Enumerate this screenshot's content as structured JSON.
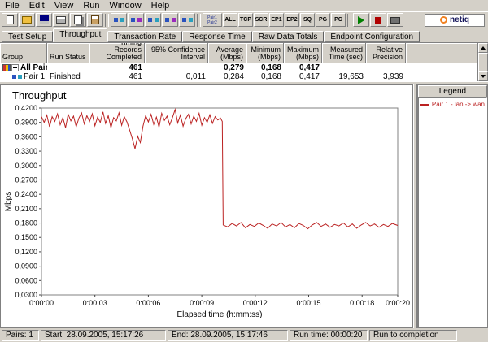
{
  "menubar": {
    "items": [
      "File",
      "Edit",
      "View",
      "Run",
      "Window",
      "Help"
    ]
  },
  "toolbar": {
    "filters": [
      "ALL",
      "TCP",
      "SCR",
      "EP1",
      "EP2",
      "SQ",
      "PG",
      "PC"
    ],
    "pair_sort": [
      "Pair1",
      "Pair2"
    ],
    "logo_text": "netiq"
  },
  "tabs": {
    "items": [
      "Test Setup",
      "Throughput",
      "Transaction Rate",
      "Response Time",
      "Raw Data Totals",
      "Endpoint Configuration"
    ],
    "active": "Throughput"
  },
  "results_table": {
    "headers": [
      "Group",
      "Run Status",
      "Timing Records\nCompleted",
      "95% Confidence\nInterval",
      "Average\n(Mbps)",
      "Minimum\n(Mbps)",
      "Maximum\n(Mbps)",
      "Measured\nTime (sec)",
      "Relative\nPrecision"
    ],
    "rows": [
      {
        "group": "All Pairs",
        "run_status": "",
        "records": "461",
        "ci": "",
        "avg": "0,279",
        "min": "0,168",
        "max": "0,417",
        "time": "",
        "precision": ""
      },
      {
        "group": "Pair 1",
        "run_status": "Finished",
        "records": "461",
        "ci": "0,011",
        "avg": "0,284",
        "min": "0,168",
        "max": "0,417",
        "time": "19,653",
        "precision": "3,939"
      }
    ]
  },
  "legend": {
    "title": "Legend",
    "entries": [
      {
        "label": "Pair 1 - lan -> wan",
        "color": "#bb2222"
      }
    ]
  },
  "statusbar": {
    "cells": [
      "Pairs: 1",
      "Start: 28.09.2005, 15:17:26",
      "End: 28.09.2005, 15:17:46",
      "Run time: 00:00:20",
      "Run to completion"
    ]
  },
  "chart_data": {
    "type": "line",
    "title": "Throughput",
    "xlabel": "Elapsed time (h:mm:ss)",
    "ylabel": "Mbps",
    "ylim": [
      0.03,
      0.42
    ],
    "xlim": [
      0,
      20
    ],
    "grid": false,
    "legend_position": "right-panel",
    "yticks": [
      {
        "v": 0.42,
        "label": "0,4200"
      },
      {
        "v": 0.39,
        "label": "0,3900"
      },
      {
        "v": 0.36,
        "label": "0,3600"
      },
      {
        "v": 0.33,
        "label": "0,3300"
      },
      {
        "v": 0.3,
        "label": "0,3000"
      },
      {
        "v": 0.27,
        "label": "0,2700"
      },
      {
        "v": 0.24,
        "label": "0,2400"
      },
      {
        "v": 0.21,
        "label": "0,2100"
      },
      {
        "v": 0.18,
        "label": "0,1800"
      },
      {
        "v": 0.15,
        "label": "0,1500"
      },
      {
        "v": 0.12,
        "label": "0,1200"
      },
      {
        "v": 0.09,
        "label": "0,0900"
      },
      {
        "v": 0.06,
        "label": "0,0600"
      },
      {
        "v": 0.03,
        "label": "0,0300"
      }
    ],
    "xticks": [
      {
        "t": 0,
        "label": "0:00:00"
      },
      {
        "t": 3,
        "label": "0:00:03"
      },
      {
        "t": 6,
        "label": "0:00:06"
      },
      {
        "t": 9,
        "label": "0:00:09"
      },
      {
        "t": 12,
        "label": "0:00:12"
      },
      {
        "t": 15,
        "label": "0:00:15"
      },
      {
        "t": 18,
        "label": "0:00:18"
      },
      {
        "t": 20,
        "label": "0:00:20"
      }
    ],
    "series": [
      {
        "name": "Pair 1 - lan -> wan",
        "color": "#bb2222",
        "points": [
          [
            0,
            0.402
          ],
          [
            0.15,
            0.39
          ],
          [
            0.3,
            0.405
          ],
          [
            0.45,
            0.381
          ],
          [
            0.6,
            0.402
          ],
          [
            0.75,
            0.392
          ],
          [
            0.9,
            0.408
          ],
          [
            1.05,
            0.385
          ],
          [
            1.2,
            0.4
          ],
          [
            1.35,
            0.379
          ],
          [
            1.5,
            0.407
          ],
          [
            1.65,
            0.393
          ],
          [
            1.8,
            0.403
          ],
          [
            1.95,
            0.381
          ],
          [
            2.1,
            0.399
          ],
          [
            2.25,
            0.41
          ],
          [
            2.4,
            0.387
          ],
          [
            2.55,
            0.404
          ],
          [
            2.7,
            0.392
          ],
          [
            2.85,
            0.408
          ],
          [
            3,
            0.383
          ],
          [
            3.15,
            0.401
          ],
          [
            3.3,
            0.39
          ],
          [
            3.45,
            0.412
          ],
          [
            3.6,
            0.388
          ],
          [
            3.75,
            0.404
          ],
          [
            3.9,
            0.379
          ],
          [
            4.05,
            0.4
          ],
          [
            4.2,
            0.393
          ],
          [
            4.35,
            0.41
          ],
          [
            4.5,
            0.384
          ],
          [
            4.65,
            0.402
          ],
          [
            4.8,
            0.391
          ],
          [
            4.95,
            0.374
          ],
          [
            5.1,
            0.356
          ],
          [
            5.25,
            0.335
          ],
          [
            5.4,
            0.361
          ],
          [
            5.55,
            0.348
          ],
          [
            5.7,
            0.382
          ],
          [
            5.85,
            0.404
          ],
          [
            6,
            0.391
          ],
          [
            6.15,
            0.407
          ],
          [
            6.3,
            0.386
          ],
          [
            6.45,
            0.401
          ],
          [
            6.6,
            0.38
          ],
          [
            6.75,
            0.409
          ],
          [
            6.9,
            0.394
          ],
          [
            7.05,
            0.403
          ],
          [
            7.2,
            0.385
          ],
          [
            7.35,
            0.4
          ],
          [
            7.5,
            0.417
          ],
          [
            7.65,
            0.389
          ],
          [
            7.8,
            0.405
          ],
          [
            7.95,
            0.382
          ],
          [
            8.1,
            0.398
          ],
          [
            8.25,
            0.407
          ],
          [
            8.4,
            0.387
          ],
          [
            8.55,
            0.403
          ],
          [
            8.7,
            0.392
          ],
          [
            8.85,
            0.409
          ],
          [
            9,
            0.384
          ],
          [
            9.15,
            0.4
          ],
          [
            9.3,
            0.39
          ],
          [
            9.45,
            0.406
          ],
          [
            9.6,
            0.388
          ],
          [
            9.75,
            0.402
          ],
          [
            9.9,
            0.395
          ],
          [
            10.05,
            0.399
          ],
          [
            10.15,
            0.392
          ],
          [
            10.2,
            0.176
          ],
          [
            10.45,
            0.172
          ],
          [
            10.7,
            0.179
          ],
          [
            10.95,
            0.174
          ],
          [
            11.2,
            0.181
          ],
          [
            11.45,
            0.17
          ],
          [
            11.7,
            0.177
          ],
          [
            11.95,
            0.173
          ],
          [
            12.2,
            0.18
          ],
          [
            12.45,
            0.175
          ],
          [
            12.7,
            0.169
          ],
          [
            12.95,
            0.178
          ],
          [
            13.2,
            0.174
          ],
          [
            13.45,
            0.181
          ],
          [
            13.7,
            0.172
          ],
          [
            13.95,
            0.177
          ],
          [
            14.2,
            0.17
          ],
          [
            14.45,
            0.179
          ],
          [
            14.7,
            0.175
          ],
          [
            14.95,
            0.168
          ],
          [
            15.2,
            0.176
          ],
          [
            15.45,
            0.181
          ],
          [
            15.7,
            0.173
          ],
          [
            15.95,
            0.178
          ],
          [
            16.2,
            0.171
          ],
          [
            16.45,
            0.177
          ],
          [
            16.7,
            0.174
          ],
          [
            16.95,
            0.18
          ],
          [
            17.2,
            0.172
          ],
          [
            17.45,
            0.178
          ],
          [
            17.7,
            0.169
          ],
          [
            17.95,
            0.176
          ],
          [
            18.2,
            0.181
          ],
          [
            18.45,
            0.174
          ],
          [
            18.7,
            0.178
          ],
          [
            18.95,
            0.171
          ],
          [
            19.2,
            0.177
          ],
          [
            19.45,
            0.173
          ],
          [
            19.7,
            0.179
          ],
          [
            20,
            0.175
          ]
        ]
      }
    ]
  }
}
